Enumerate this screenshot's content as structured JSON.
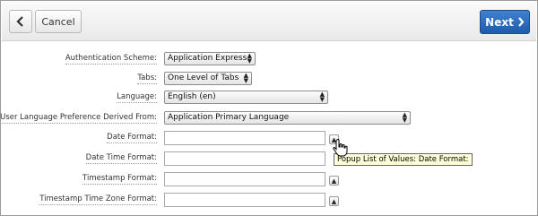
{
  "toolbar": {
    "back_icon": "chevron-left-icon",
    "cancel_label": "Cancel",
    "next_label": "Next",
    "next_icon": "chevron-right-icon",
    "next_color": "#2a67b6"
  },
  "form": {
    "authentication_scheme": {
      "label": "Authentication Scheme:",
      "value": "Application Express"
    },
    "tabs": {
      "label": "Tabs:",
      "value": "One Level of Tabs"
    },
    "language": {
      "label": "Language:",
      "value": "English (en)"
    },
    "user_language_pref": {
      "label": "User Language Preference Derived From:",
      "value": "Application Primary Language"
    },
    "date_format": {
      "label": "Date Format:",
      "value": ""
    },
    "date_time_format": {
      "label": "Date Time Format:",
      "value": ""
    },
    "timestamp_format": {
      "label": "Timestamp Format:",
      "value": ""
    },
    "timestamp_tz_format": {
      "label": "Timestamp Time Zone Format:",
      "value": ""
    }
  },
  "tooltip": {
    "text": "Popup List of Values: Date Format:"
  }
}
